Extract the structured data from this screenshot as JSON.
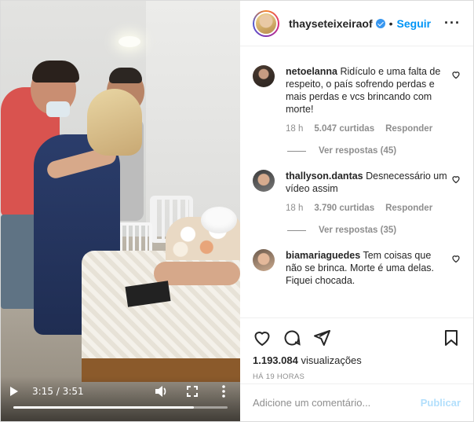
{
  "post": {
    "username": "thayseteixeiraof",
    "follow_label": "Seguir",
    "separator": "•",
    "more_label": "···"
  },
  "video": {
    "current_time": "3:15",
    "duration": "3:51",
    "separator": "/",
    "progress_fraction": 0.844
  },
  "comments": [
    {
      "username": "netoelanna",
      "text": "Ridículo e uma falta de respeito, o país sofrendo perdas e mais perdas e vcs brincando com morte!",
      "age": "18 h",
      "likes": "5.047 curtidas",
      "reply_label": "Responder",
      "view_replies": "Ver respostas (45)"
    },
    {
      "username": "thallyson.dantas",
      "text": "Desnecessário um vídeo assim",
      "age": "18 h",
      "likes": "3.790 curtidas",
      "reply_label": "Responder",
      "view_replies": "Ver respostas (35)"
    },
    {
      "username": "biamariaguedes",
      "text": "Tem coisas que não se brinca. Morte é uma delas. Fiquei chocada.",
      "age": "",
      "likes": "",
      "reply_label": "",
      "view_replies": ""
    }
  ],
  "stats": {
    "views_number": "1.193.084",
    "views_label": "visualizações",
    "time_ago": "HÁ 19 HORAS"
  },
  "add_comment": {
    "placeholder": "Adicione um comentário...",
    "publish_label": "Publicar"
  },
  "colors": {
    "accent": "#0095f6",
    "publish_disabled": "#b2dffc",
    "muted": "#8e8e8e"
  }
}
